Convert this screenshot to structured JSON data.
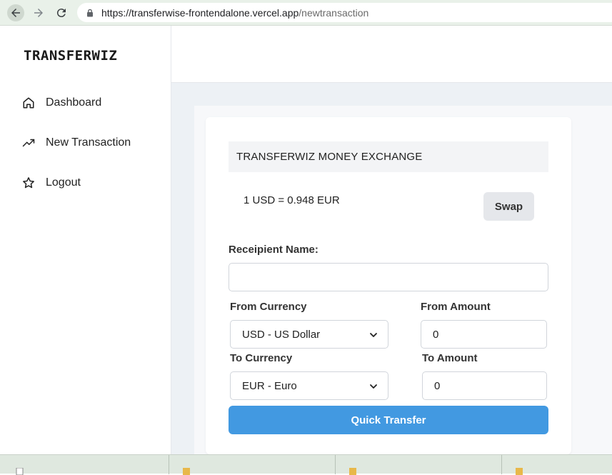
{
  "browser": {
    "url_host": "https://transferwise-frontendalone.vercel.app",
    "url_path": "/newtransaction"
  },
  "sidebar": {
    "brand": "TRANSFERWIZ",
    "items": [
      {
        "label": "Dashboard",
        "icon": "home-icon"
      },
      {
        "label": "New Transaction",
        "icon": "trending-up-icon"
      },
      {
        "label": "Logout",
        "icon": "star-icon"
      }
    ]
  },
  "exchange": {
    "title": "TRANSFERWIZ MONEY EXCHANGE",
    "rate_text": "1 USD = 0.948 EUR",
    "swap_label": "Swap",
    "recipient_label": "Receipient Name:",
    "recipient_value": "",
    "from_currency_label": "From Currency",
    "from_currency_value": "USD - US Dollar",
    "from_amount_label": "From Amount",
    "from_amount_value": "0",
    "to_currency_label": "To Currency",
    "to_currency_value": "EUR - Euro",
    "to_amount_label": "To Amount",
    "to_amount_value": "0",
    "submit_label": "Quick Transfer"
  },
  "colors": {
    "primary_button": "#4299e1",
    "main_background": "#edf1f5"
  }
}
